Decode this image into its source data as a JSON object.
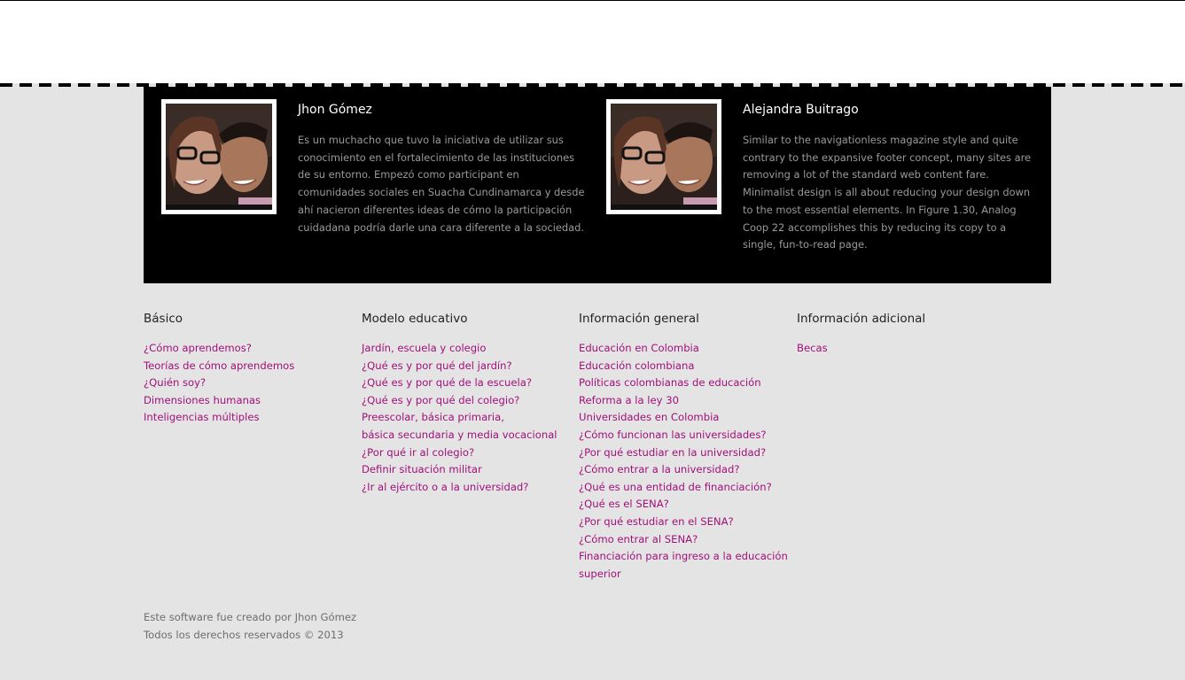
{
  "authors": [
    {
      "name": "Jhon Gómez",
      "bio_lines": [
        "Es un muchacho que tuvo la iniciativa de utilizar sus",
        "conocimiento en el fortalecimiento de las instituciones",
        "de su entorno. Empezó como participant en",
        "comunidades sociales en Suacha Cundinamarca y desde",
        "ahí nacieron diferentes ideas de cómo la participación",
        "cuidadana podría darle una cara diferente a la sociedad."
      ]
    },
    {
      "name": "Alejandra Buitrago",
      "bio_lines": [
        "Similar to the navigationless magazine style and quite",
        "contrary to the expansive footer concept, many sites are",
        "removing a lot of the standard web content fare.",
        "Minimalist design is all about reducing your design down",
        "to the most essential elements. In Figure 1.30, Analog",
        "Coop 22 accomplishes this by reducing its copy to a",
        "single, fun-to-read page."
      ]
    }
  ],
  "footer_columns": [
    {
      "title": "Básico",
      "links": [
        "¿Cómo aprendemos?",
        "Teorías de cómo aprendemos",
        "¿Quién soy?",
        "Dimensiones humanas",
        "Inteligencias múltiples"
      ]
    },
    {
      "title": "Modelo educativo",
      "links": [
        "Jardín, escuela y colegio",
        "¿Qué es y por qué del jardín?",
        "¿Qué es y por qué de la escuela?",
        "¿Qué es y por qué del colegio?",
        "Preescolar, básica primaria,",
        "básica secundaria y media vocacional",
        "¿Por qué ir al colegio?",
        "Definir situación militar",
        "¿Ir al ejército o a la universidad?"
      ]
    },
    {
      "title": "Información general",
      "links": [
        "Educación en Colombia",
        "Educación colombiana",
        "Políticas colombianas de educación",
        "Reforma a la ley 30",
        "Universidades en Colombia",
        "¿Cómo funcionan las universidades?",
        "¿Por qué estudiar en la universidad?",
        "¿Cómo entrar a la universidad?",
        "¿Qué es una entidad de financiación?",
        "¿Qué es el SENA?",
        "¿Por qué estudiar en el SENA?",
        "¿Cómo entrar al SENA?",
        "Financiación para ingreso a la educación",
        "superior"
      ]
    },
    {
      "title": "Información adicional",
      "links": [
        "Becas"
      ]
    }
  ],
  "credits": {
    "line1": "Este software fue creado por Jhon Gómez",
    "line2": "Todos los derechos reservados © 2013"
  },
  "colors": {
    "link": "#a0107a",
    "page_bg": "#e5e4e4",
    "authors_bg": "#000000"
  }
}
